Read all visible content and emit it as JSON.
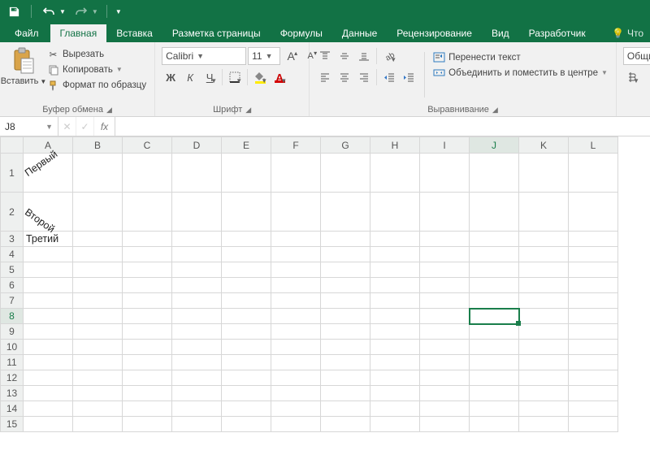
{
  "qat": {
    "save": "save",
    "undo": "undo",
    "redo": "redo"
  },
  "tabs": {
    "file": "Файл",
    "items": [
      "Главная",
      "Вставка",
      "Разметка страницы",
      "Формулы",
      "Данные",
      "Рецензирование",
      "Вид",
      "Разработчик"
    ],
    "active_index": 0,
    "tell_me": "Что"
  },
  "ribbon": {
    "clipboard": {
      "paste": "Вставить",
      "cut": "Вырезать",
      "copy": "Копировать",
      "format_painter": "Формат по образцу",
      "group_label": "Буфер обмена"
    },
    "font": {
      "name": "Calibri",
      "size": "11",
      "group_label": "Шрифт"
    },
    "alignment": {
      "wrap": "Перенести текст",
      "merge": "Объединить и поместить в центре",
      "group_label": "Выравнивание"
    },
    "number": {
      "format": "Общи"
    }
  },
  "namebox": {
    "ref": "J8",
    "fx": "fx"
  },
  "sheet": {
    "columns": [
      "A",
      "B",
      "C",
      "D",
      "E",
      "F",
      "G",
      "H",
      "I",
      "J",
      "K",
      "L"
    ],
    "rows": [
      1,
      2,
      3,
      4,
      5,
      6,
      7,
      8,
      9,
      10,
      11,
      12,
      13,
      14,
      15
    ],
    "tall_rows": [
      1,
      2
    ],
    "cells": {
      "A1": {
        "v": "Первый",
        "rot": "up"
      },
      "A2": {
        "v": "Второй",
        "rot": "down"
      },
      "A3": {
        "v": "Третий"
      }
    },
    "selected": "J8"
  }
}
